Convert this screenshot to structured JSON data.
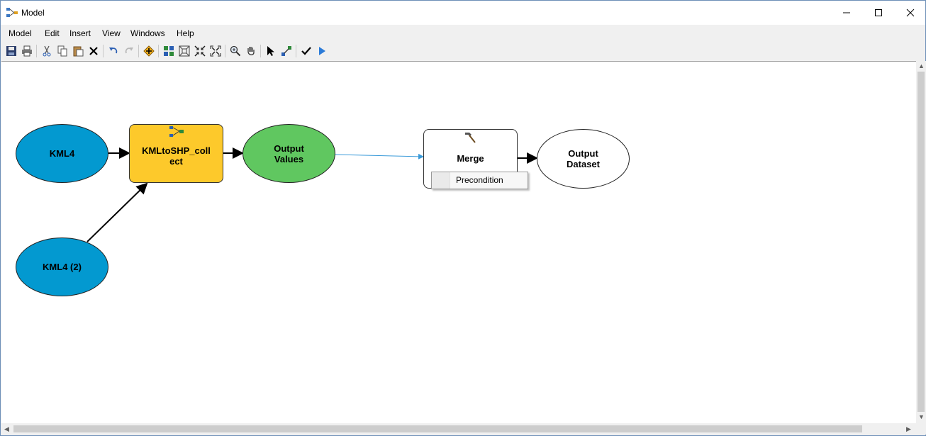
{
  "window": {
    "title": "Model"
  },
  "menu": [
    "Model",
    "Edit",
    "Insert",
    "View",
    "Windows",
    "Help"
  ],
  "toolbar": {
    "icons": [
      "save-icon",
      "print-icon",
      "cut-icon",
      "copy-icon",
      "paste-icon",
      "delete-icon",
      "undo-icon",
      "redo-icon",
      "add-data-icon",
      "auto-layout-icon",
      "full-extent-icon",
      "zoom-in-fixed-icon",
      "zoom-out-fixed-icon",
      "zoom-icon",
      "pan-icon",
      "select-icon",
      "connect-icon",
      "validate-icon",
      "run-icon"
    ]
  },
  "model": {
    "nodes": {
      "kml4": {
        "label": "KML4",
        "color": "#0399d0"
      },
      "kml4_2": {
        "label": "KML4 (2)",
        "color": "#0399d0"
      },
      "kmltoshp": {
        "label": "KMLtoSHP_coll ect",
        "color": "#fdc92b"
      },
      "output_values": {
        "label": "Output Values",
        "color": "#60c760"
      },
      "merge": {
        "label": "Merge",
        "color": "#ffffff"
      },
      "output_dataset": {
        "label": "Output Dataset",
        "color": "#ffffff"
      }
    },
    "context_item": "Precondition",
    "precondition_line_color": "#3a9ad9"
  }
}
